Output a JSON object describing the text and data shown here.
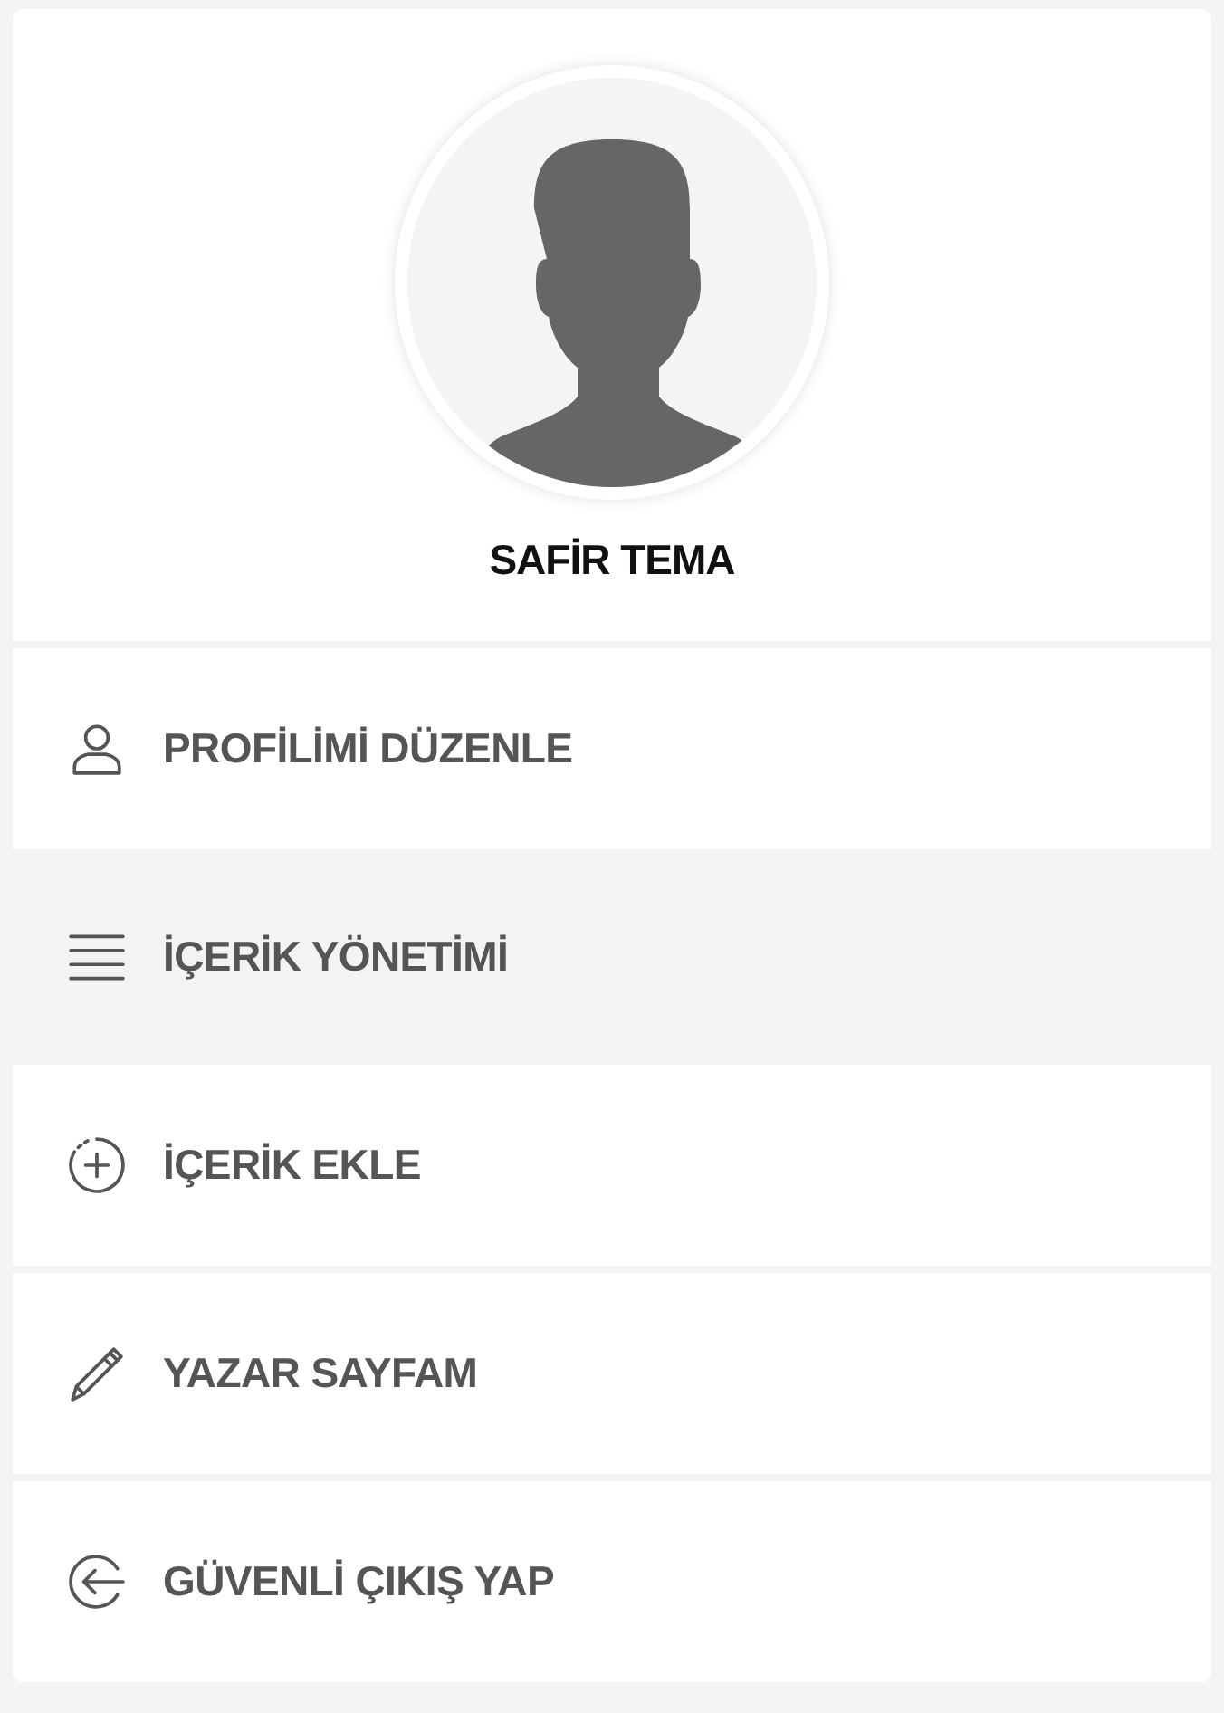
{
  "profile": {
    "name": "SAFİR TEMA"
  },
  "menu": [
    {
      "label": "PROFİLİMİ DÜZENLE",
      "selected": false
    },
    {
      "label": "İÇERİK YÖNETİMİ",
      "selected": true
    },
    {
      "label": "İÇERİK EKLE",
      "selected": false
    },
    {
      "label": "YAZAR SAYFAM",
      "selected": false
    },
    {
      "label": "GÜVENLİ ÇIKIŞ YAP",
      "selected": false
    }
  ]
}
